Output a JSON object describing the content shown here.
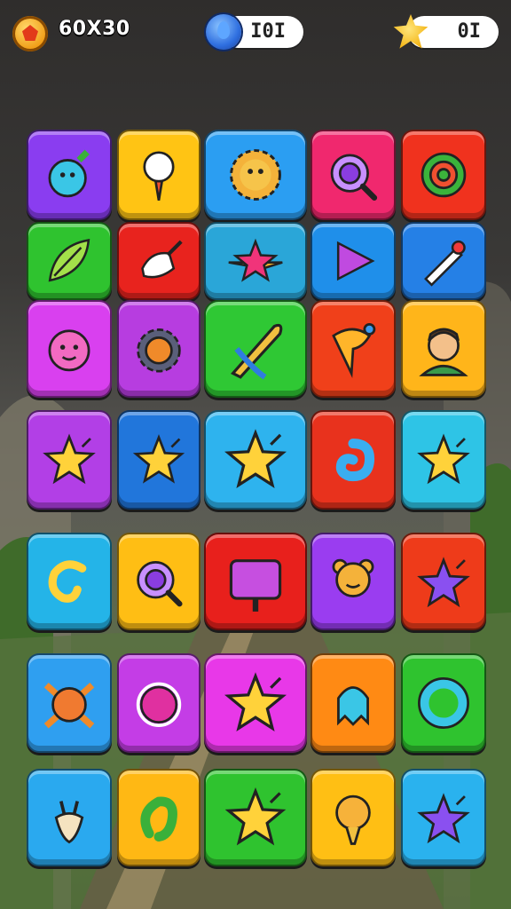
{
  "hud": {
    "coins_text": "60X30",
    "drops_text": "I0I",
    "stars_text": "0I"
  },
  "board": {
    "rows": [
      [
        {
          "color": "#8a3df0",
          "icon": "blue-creature-icon"
        },
        {
          "color": "#ffc414",
          "icon": "balloon-face-icon"
        },
        {
          "color": "#2b9ef2",
          "icon": "sun-face-icon"
        },
        {
          "color": "#f0286e",
          "icon": "magnifier-icon"
        },
        {
          "color": "#f0321e",
          "icon": "target-icon"
        }
      ],
      [
        {
          "color": "#2fc32f",
          "icon": "leaf-icon"
        },
        {
          "color": "#e8231e",
          "icon": "pick-icon"
        },
        {
          "color": "#2aa6d8",
          "icon": "pink-star-icon"
        },
        {
          "color": "#1f8fea",
          "icon": "play-triangle-icon"
        },
        {
          "color": "#2580e6",
          "icon": "pencil-icon"
        }
      ],
      [
        {
          "color": "#d940ef",
          "icon": "pink-virus-icon"
        },
        {
          "color": "#b73de0",
          "icon": "gear-face-icon"
        },
        {
          "color": "#2fc834",
          "icon": "rocket-icon"
        },
        {
          "color": "#f0401a",
          "icon": "tree-icon"
        },
        {
          "color": "#ffb51a",
          "icon": "boy-avatar-icon"
        }
      ],
      [
        {
          "color": "#b23fe6",
          "icon": "star-icon"
        },
        {
          "color": "#2176db",
          "icon": "star-icon"
        },
        {
          "color": "#2eb3ee",
          "icon": "star-icon"
        },
        {
          "color": "#e8321d",
          "icon": "swirl-icon"
        },
        {
          "color": "#2ec4e6",
          "icon": "star-icon"
        }
      ],
      [
        {
          "color": "#24b4e8",
          "icon": "swirl-c-icon"
        },
        {
          "color": "#ffbe14",
          "icon": "magnifier-icon"
        },
        {
          "color": "#e8201c",
          "icon": "sign-icon"
        },
        {
          "color": "#9a3df0",
          "icon": "bear-face-icon"
        },
        {
          "color": "#ee3b1a",
          "icon": "purple-star-icon"
        }
      ],
      [
        {
          "color": "#2f9ff0",
          "icon": "crossbones-face-icon"
        },
        {
          "color": "#c43de6",
          "icon": "orb-icon"
        },
        {
          "color": "#e838e8",
          "icon": "star-icon"
        },
        {
          "color": "#ff8a14",
          "icon": "ghost-icon"
        },
        {
          "color": "#2fc32f",
          "icon": "ring-icon"
        }
      ],
      [
        {
          "color": "#2aa9ef",
          "icon": "bunny-icon"
        },
        {
          "color": "#ffb814",
          "icon": "letter-a-icon"
        },
        {
          "color": "#2fc32f",
          "icon": "star-icon"
        },
        {
          "color": "#ffbf14",
          "icon": "lightbulb-icon"
        },
        {
          "color": "#2ab2ee",
          "icon": "purple-star-icon"
        }
      ]
    ]
  }
}
